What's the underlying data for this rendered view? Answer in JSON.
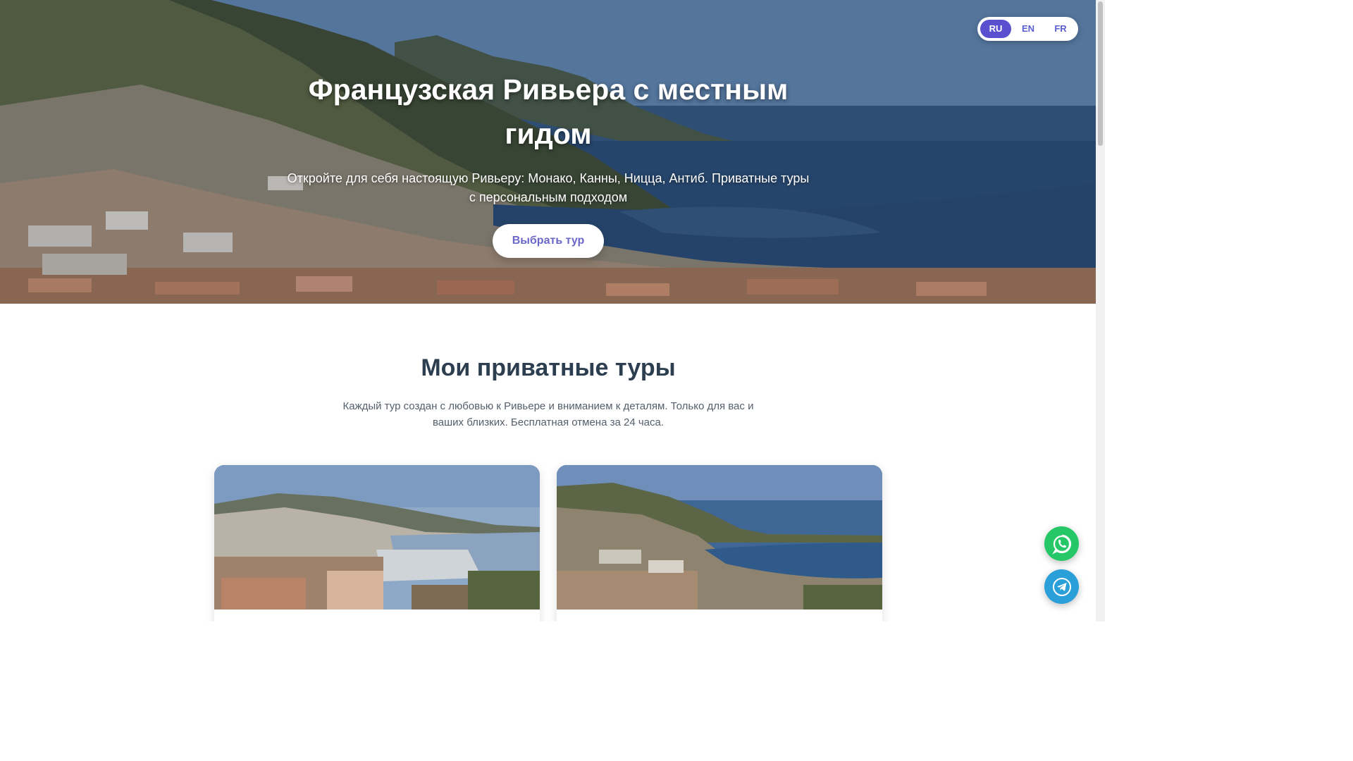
{
  "languages": [
    {
      "code": "RU",
      "active": true
    },
    {
      "code": "EN",
      "active": false
    },
    {
      "code": "FR",
      "active": false
    }
  ],
  "hero": {
    "title": "Французская Ривьера с местным гидом",
    "subtitle": "Откройте для себя настоящую Ривьеру: Монако, Канны, Ницца, Антиб. Приватные туры с персональным подходом",
    "cta_label": "Выбрать тур",
    "background_image": "coastal-riviera-town-photo"
  },
  "tours": {
    "title": "Мои приватные туры",
    "description": "Каждый тур создан с любовью к Ривьере и вниманием к деталям. Только для вас и ваших близких. Бесплатная отмена за 24 часа.",
    "cards": [
      {
        "image": "monaco-harbor-photo"
      },
      {
        "image": "villefranche-bay-photo"
      }
    ]
  },
  "floating": {
    "whatsapp_icon": "whatsapp-icon",
    "telegram_icon": "telegram-icon",
    "whatsapp_color": "#25c766",
    "telegram_color": "#2a9fd8"
  },
  "colors": {
    "accent": "#5a4fcf",
    "heading": "#2c3e50"
  }
}
